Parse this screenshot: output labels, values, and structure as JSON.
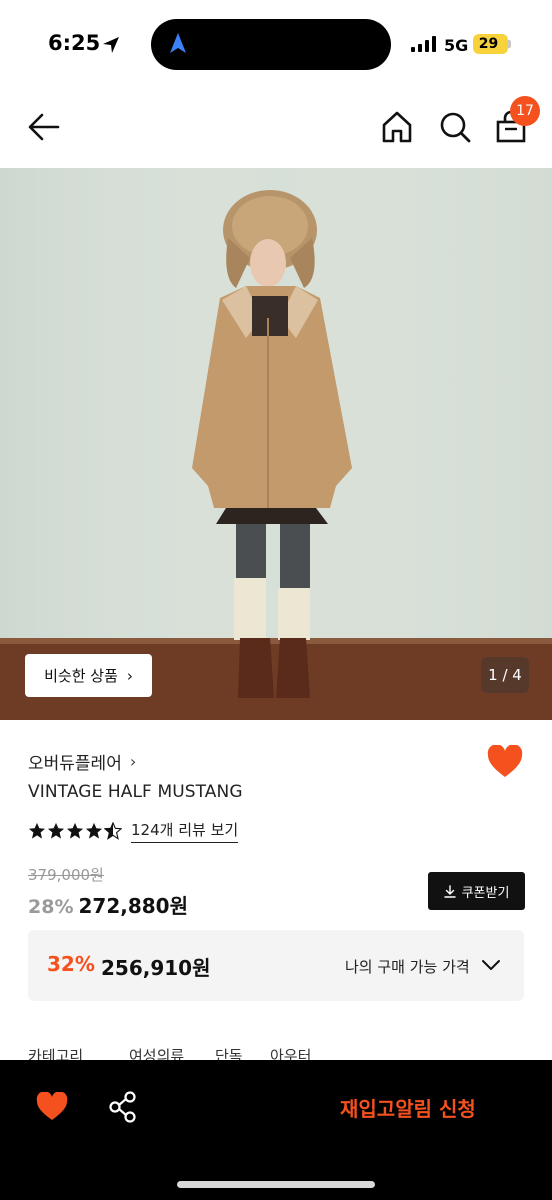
{
  "status_bar": {
    "time": "6:25",
    "network": "5G",
    "battery": "29"
  },
  "header": {
    "cart_count": "17"
  },
  "gallery": {
    "similar_label": "비슷한 상품",
    "page_counter": "1 / 4"
  },
  "product": {
    "brand": "오버듀플레어",
    "name": "VINTAGE HALF MUSTANG",
    "rating": 4.5,
    "review_link": "124개 리뷰 보기",
    "original_price": "379,000원",
    "discount": "28%",
    "sale_price": "272,880원",
    "coupon_label": "쿠폰받기"
  },
  "best_price": {
    "discount": "32%",
    "price": "256,910원",
    "label": "나의 구매 가능 가격"
  },
  "category": {
    "label": "카테고리",
    "path": [
      "여성의류",
      "단독",
      "아우터"
    ]
  },
  "bottom_bar": {
    "restock_label": "재입고알림 신청"
  },
  "colors": {
    "accent": "#f4511e",
    "dark": "#000000"
  },
  "icons": [
    "location-arrow-icon",
    "navigation-icon",
    "signal-icon",
    "battery-icon",
    "back-arrow-icon",
    "home-icon",
    "search-icon",
    "shopping-bag-icon",
    "heart-icon",
    "star-icon",
    "download-icon",
    "chevron-down-icon",
    "share-icon"
  ]
}
